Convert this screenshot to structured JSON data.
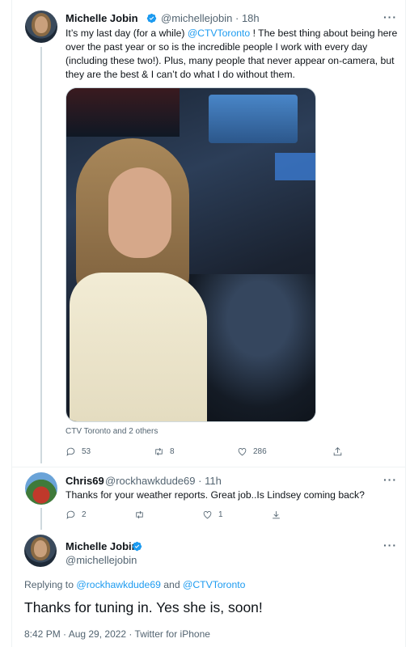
{
  "tweet1": {
    "name": "Michelle Jobin",
    "handle": "@michellejobin",
    "time": "18h",
    "text_before_mention": "It’s my last day (for a while) ",
    "mention": "@CTVToronto",
    "text_after_mention": " ! The best thing about being here over the past year or so is the incredible people I work with every day (including these two!). Plus, many people that never appear on-camera, but they are the best  & I can’t do what I do without them.",
    "photo_caption": "CTV Toronto and 2 others",
    "actions": {
      "replies": "53",
      "retweets": "8",
      "likes": "286"
    }
  },
  "tweet2": {
    "name": "Chris69",
    "handle": "@rockhawkdude69",
    "time": "11h",
    "text": "Thanks for your weather reports. Great job..Is Lindsey coming back?",
    "actions": {
      "replies": "2",
      "retweets": "",
      "likes": "1"
    }
  },
  "tweet3": {
    "name": "Michelle Jobin",
    "handle": "@michellejobin",
    "replying_label": "Replying to ",
    "replying_user1": "@rockhawkdude69",
    "replying_and": " and ",
    "replying_user2": "@CTVToronto",
    "text": "Thanks for tuning in. Yes she is, soon!",
    "timestamp": "8:42 PM · Aug 29, 2022 · Twitter for iPhone"
  },
  "more_glyph": "···",
  "dot_separator": "·",
  "colors": {
    "link": "#1d9bf0",
    "verified": "#1d9bf0",
    "secondary": "#536471"
  },
  "icons": [
    "verified-badge-icon",
    "more-icon",
    "reply-icon",
    "retweet-icon",
    "like-icon",
    "share-icon"
  ]
}
